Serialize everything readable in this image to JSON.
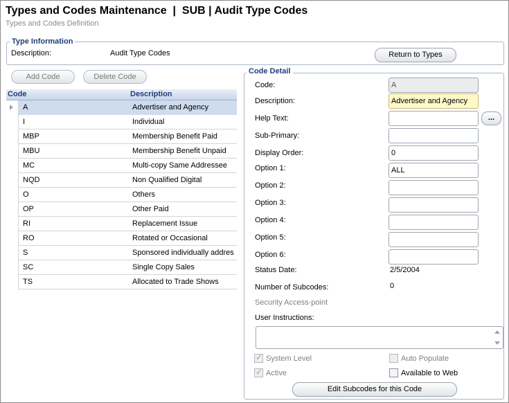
{
  "page": {
    "title": "Types and Codes Maintenance  |  SUB | Audit Type Codes",
    "subtitle": "Types and Codes Definition"
  },
  "type_info": {
    "legend": "Type Information",
    "description_label": "Description:",
    "description_value": "Audit Type Codes",
    "return_button": "Return to Types"
  },
  "toolbar": {
    "add_label": "Add Code",
    "delete_label": "Delete Code"
  },
  "grid": {
    "columns": [
      "Code",
      "Description"
    ],
    "rows": [
      {
        "code": "A",
        "description": "Advertiser and Agency"
      },
      {
        "code": "I",
        "description": "Individual"
      },
      {
        "code": "MBP",
        "description": "Membership Benefit Paid"
      },
      {
        "code": "MBU",
        "description": "Membership Benefit Unpaid"
      },
      {
        "code": "MC",
        "description": "Multi-copy Same Addressee"
      },
      {
        "code": "NQD",
        "description": "Non Qualified Digital"
      },
      {
        "code": "O",
        "description": "Others"
      },
      {
        "code": "OP",
        "description": "Other Paid"
      },
      {
        "code": "RI",
        "description": "Replacement Issue"
      },
      {
        "code": "RO",
        "description": "Rotated or Occasional"
      },
      {
        "code": "S",
        "description": "Sponsored individually addres"
      },
      {
        "code": "SC",
        "description": "Single Copy Sales"
      },
      {
        "code": "TS",
        "description": "Allocated to Trade Shows"
      }
    ]
  },
  "detail": {
    "legend": "Code Detail",
    "code_label": "Code:",
    "code_value": "A",
    "description_label": "Description:",
    "description_value": "Advertiser and Agency",
    "help_label": "Help Text:",
    "help_value": "",
    "help_button": "...",
    "subprimary_label": "Sub-Primary:",
    "subprimary_value": "",
    "display_order_label": "Display Order:",
    "display_order_value": "0",
    "option1_label": "Option 1:",
    "option1_value": "ALL",
    "option2_label": "Option 2:",
    "option2_value": "",
    "option3_label": "Option 3:",
    "option3_value": "",
    "option4_label": "Option 4:",
    "option4_value": "",
    "option5_label": "Option 5:",
    "option5_value": "",
    "option6_label": "Option 6:",
    "option6_value": "",
    "status_date_label": "Status Date:",
    "status_date_value": "2/5/2004",
    "subcodes_label": "Number of Subcodes:",
    "subcodes_value": "0",
    "security_label": "Security Access-point",
    "instructions_label": "User Instructions:",
    "system_level_label": "System Level",
    "active_label": "Active",
    "auto_populate_label": "Auto Populate",
    "available_web_label": "Available to Web",
    "edit_subcodes_button": "Edit Subcodes for this Code",
    "checks": {
      "system_level": true,
      "active": true,
      "auto_populate": false,
      "available_web": false
    }
  }
}
